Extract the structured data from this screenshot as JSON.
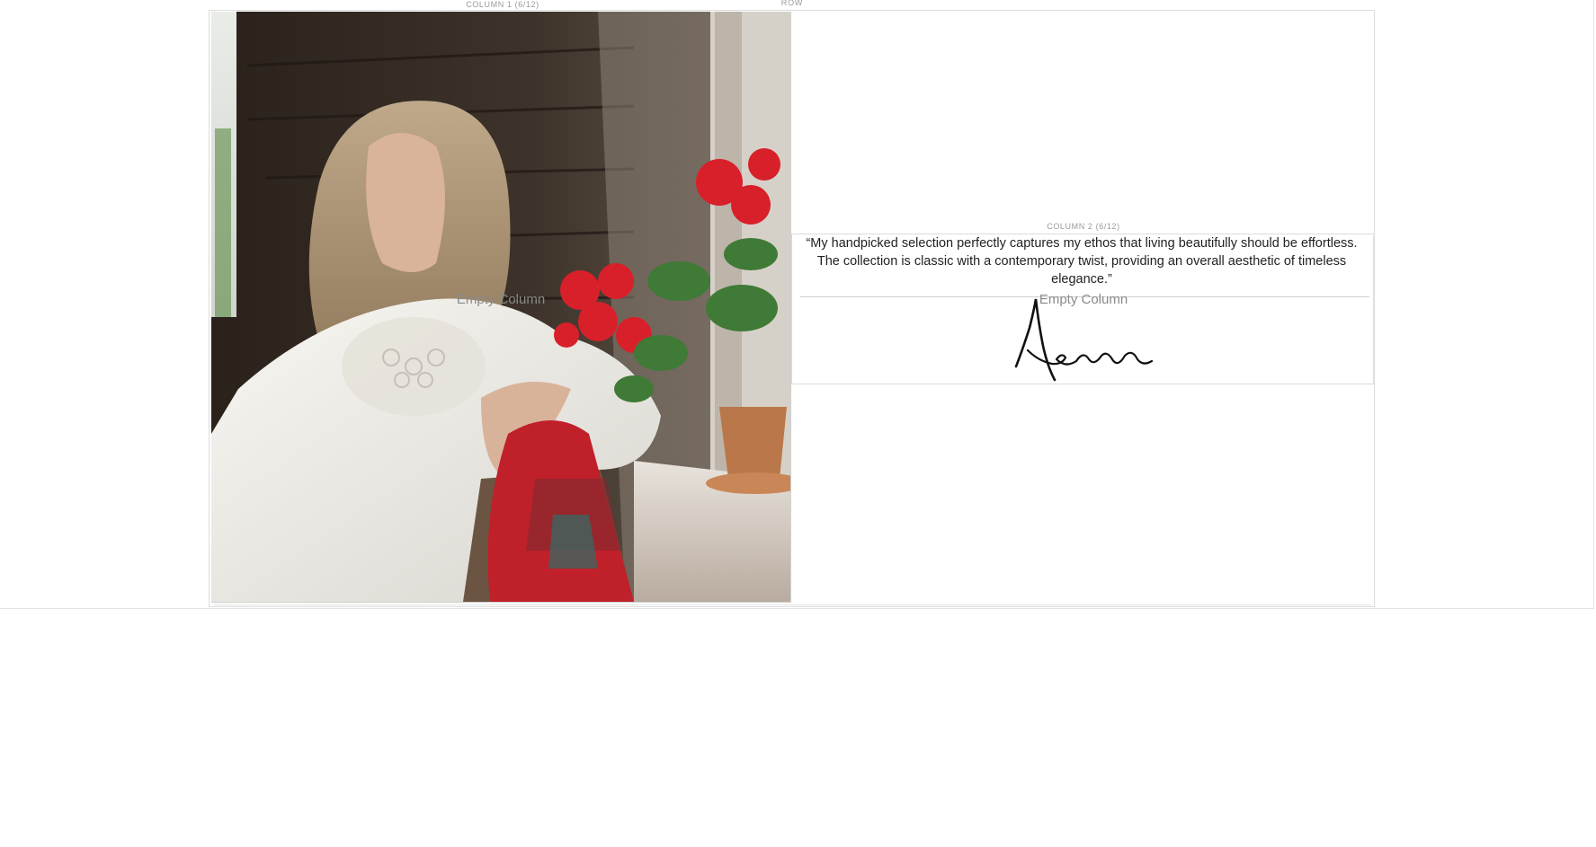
{
  "row": {
    "label": "ROW"
  },
  "columns": [
    {
      "label": "COLUMN 1 (6/12)",
      "placeholder": "Empty Column"
    },
    {
      "label": "COLUMN 2 (6/12)",
      "placeholder": "Empty Column"
    }
  ],
  "photo": {
    "alt": "Woman in white lace blouse by a window with red geraniums"
  },
  "quote": {
    "text": "“My handpicked selection perfectly captures my ethos that living beautifully should be effortless. The collection is classic with a contemporary twist, providing an overall aesthetic of timeless elegance.”"
  },
  "signature": {
    "text": "Aerin"
  },
  "colors": {
    "frame": "#dcdcdc",
    "label": "#9a9a9a",
    "text": "#222222",
    "geranium": "#d8202a"
  }
}
